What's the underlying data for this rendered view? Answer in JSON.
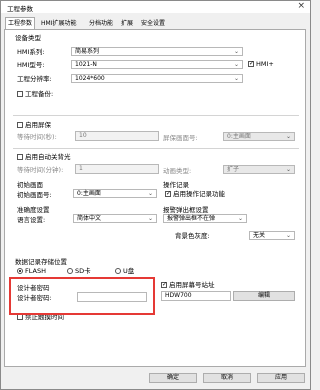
{
  "window": {
    "title": "工程参数",
    "close": "×"
  },
  "tabs": [
    "工程参数",
    "HMI扩展功能",
    "分档功能",
    "扩展",
    "安全设置"
  ],
  "device": {
    "section": "设备类型",
    "series_label": "HMI系列:",
    "series_value": "简易系列",
    "model_label": "HMI型号:",
    "model_value": "1021-N",
    "hmi_plus_label": "HMI+",
    "resolution_label": "工程分辨率:",
    "resolution_value": "1024*600",
    "pwd_label": "工程备份:"
  },
  "screensaver": {
    "label": "启用屏保",
    "wait_label": "等待时间(秒):",
    "wait_value": "10",
    "screen_label": "屏保画面号:",
    "screen_value": "0:主画面"
  },
  "backlight": {
    "label": "启用自动关背光",
    "wait_label": "等待时间(分钟):",
    "wait_value": "1",
    "action_label": "动画类型:",
    "action_value": "扩子"
  },
  "start": {
    "section": "初始画面",
    "screen_label": "初始画面号:",
    "screen_value": "0:主画面"
  },
  "operation": {
    "section": "操作记录",
    "chk_label": "启用操作记录功能"
  },
  "lang": {
    "section": "准确度设置",
    "label": "语言设置:",
    "value": "简体中文"
  },
  "alarm": {
    "section": "报警弹出框设置",
    "value": "报警弹出框不在弹"
  },
  "bg": {
    "label": "背景色灰度:",
    "value": "无关"
  },
  "storage": {
    "section": "数据记录存储位置",
    "options": [
      "FLASH",
      "SD卡",
      "U盘"
    ]
  },
  "design": {
    "section": "设计者密码",
    "pwd_label": "设计者密码:",
    "pwd_value": ""
  },
  "station": {
    "chk_label": "启用屏幕号站址",
    "value": "HDW700",
    "edit_btn": "编辑"
  },
  "bottom_chk": "禁止触摸时间",
  "buttons": {
    "ok": "确定",
    "cancel": "取消",
    "apply": "应用"
  }
}
